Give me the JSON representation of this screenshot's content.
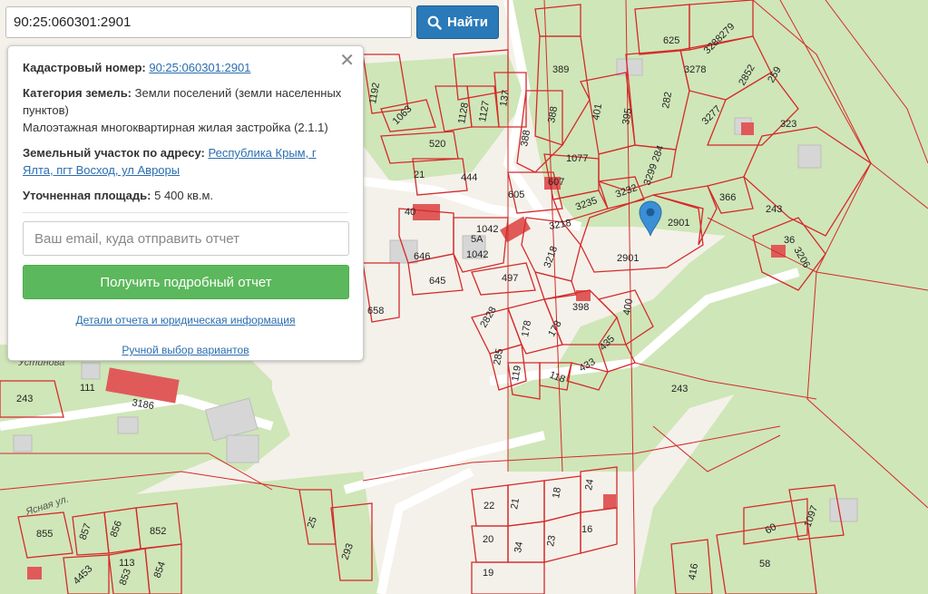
{
  "search": {
    "value": "90:25:060301:2901",
    "button_label": "Найти",
    "button_icon": "search-icon"
  },
  "info_panel": {
    "cadastral_label": "Кадастровый номер:",
    "cadastral_value": "90:25:060301:2901",
    "category_label": "Категория земель:",
    "category_value": "Земли поселений (земли населенных пунктов)",
    "usage": "Малоэтажная многоквартирная жилая застройка (2.1.1)",
    "address_label": "Земельный участок по адресу:",
    "address_value": "Республика Крым, г Ялта, пгт Восход, ул Авроры",
    "area_label": "Уточненная площадь:",
    "area_value": "5 400 кв.м.",
    "email_placeholder": "Ваш email, куда отправить отчет",
    "report_button": "Получить подробный отчет",
    "details_link": "Детали отчета и юридическая информация",
    "manual_link": "Ручной выбор вариантов",
    "close_icon": "close-icon"
  },
  "map": {
    "marker_icon": "map-pin-icon",
    "colors": {
      "parcel_border": "#d42a2a",
      "green": "#cfe6b8",
      "background": "#f4f1ea",
      "building": "#d9d9d9",
      "marker": "#3a8fd6"
    },
    "parcel_labels": [
      "2901",
      "2901",
      "243",
      "243",
      "3206",
      "366",
      "36",
      "3232",
      "3235",
      "3218",
      "3218",
      "1077",
      "3299 284",
      "395",
      "401",
      "388",
      "388",
      "389",
      "625",
      "3288279",
      "3278",
      "282",
      "3277",
      "2852",
      "259",
      "323",
      "137",
      "1127",
      "1128",
      "1063",
      "1192",
      "520",
      "21",
      "444",
      "40",
      "605",
      "607",
      "1042",
      "1042",
      "5А",
      "646",
      "645",
      "497",
      "658",
      "398",
      "400",
      "435",
      "433",
      "118",
      "119",
      "285",
      "2828",
      "178",
      "178",
      "111",
      "3186",
      "243",
      "855",
      "857",
      "856",
      "852",
      "4453",
      "853",
      "854",
      "113",
      "25",
      "293",
      "22",
      "21",
      "18",
      "24",
      "20",
      "34",
      "23",
      "16",
      "19",
      "1097",
      "60",
      "58",
      "416"
    ],
    "street_labels": [
      "Устинова",
      "Ясная ул."
    ]
  }
}
